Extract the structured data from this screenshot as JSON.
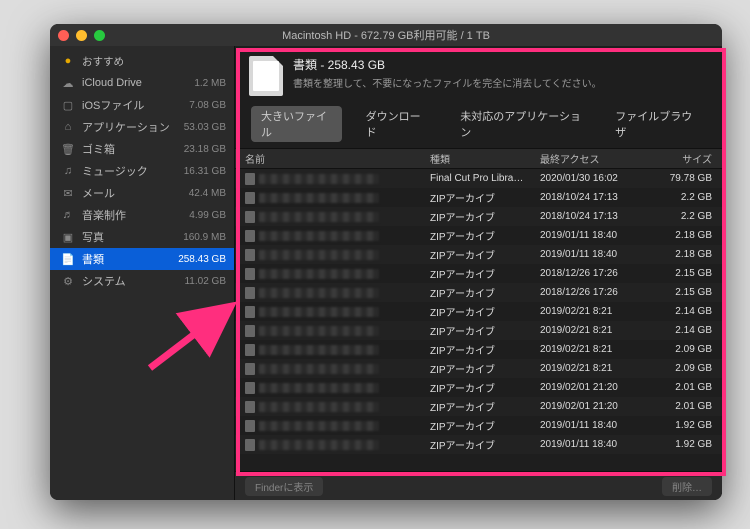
{
  "window_title": "Macintosh HD - 672.79 GB利用可能 / 1 TB",
  "sidebar": {
    "header": {
      "label": "おすすめ",
      "icon": "●"
    },
    "items": [
      {
        "icon": "☁",
        "label": "iCloud Drive",
        "size": "1.2 MB"
      },
      {
        "icon": "▢",
        "label": "iOSファイル",
        "size": "7.08 GB"
      },
      {
        "icon": "⌂",
        "label": "アプリケーション",
        "size": "53.03 GB"
      },
      {
        "icon": "🗑",
        "label": "ゴミ箱",
        "size": "23.18 GB"
      },
      {
        "icon": "♫",
        "label": "ミュージック",
        "size": "16.31 GB"
      },
      {
        "icon": "✉",
        "label": "メール",
        "size": "42.4 MB"
      },
      {
        "icon": "♬",
        "label": "音楽制作",
        "size": "4.99 GB"
      },
      {
        "icon": "▣",
        "label": "写真",
        "size": "160.9 MB"
      },
      {
        "icon": "📄",
        "label": "書類",
        "size": "258.43 GB",
        "selected": true
      },
      {
        "icon": "⚙",
        "label": "システム",
        "size": "11.02 GB"
      }
    ]
  },
  "hero": {
    "title": "書類 - 258.43 GB",
    "subtitle": "書類を整理して、不要になったファイルを完全に消去してください。"
  },
  "tabs": [
    {
      "label": "大きいファイル",
      "active": true
    },
    {
      "label": "ダウンロード"
    },
    {
      "label": "未対応のアプリケーション"
    },
    {
      "label": "ファイルブラウザ"
    }
  ],
  "columns": {
    "name": "名前",
    "kind": "種類",
    "date": "最終アクセス",
    "size": "サイズ"
  },
  "rows": [
    {
      "kind": "Final Cut Pro Libra…",
      "date": "2020/01/30 16:02",
      "size": "79.78 GB"
    },
    {
      "kind": "ZIPアーカイブ",
      "date": "2018/10/24 17:13",
      "size": "2.2 GB"
    },
    {
      "kind": "ZIPアーカイブ",
      "date": "2018/10/24 17:13",
      "size": "2.2 GB"
    },
    {
      "kind": "ZIPアーカイブ",
      "date": "2019/01/11 18:40",
      "size": "2.18 GB"
    },
    {
      "kind": "ZIPアーカイブ",
      "date": "2019/01/11 18:40",
      "size": "2.18 GB"
    },
    {
      "kind": "ZIPアーカイブ",
      "date": "2018/12/26 17:26",
      "size": "2.15 GB"
    },
    {
      "kind": "ZIPアーカイブ",
      "date": "2018/12/26 17:26",
      "size": "2.15 GB"
    },
    {
      "kind": "ZIPアーカイブ",
      "date": "2019/02/21 8:21",
      "size": "2.14 GB"
    },
    {
      "kind": "ZIPアーカイブ",
      "date": "2019/02/21 8:21",
      "size": "2.14 GB"
    },
    {
      "kind": "ZIPアーカイブ",
      "date": "2019/02/21 8:21",
      "size": "2.09 GB"
    },
    {
      "kind": "ZIPアーカイブ",
      "date": "2019/02/21 8:21",
      "size": "2.09 GB"
    },
    {
      "kind": "ZIPアーカイブ",
      "date": "2019/02/01 21:20",
      "size": "2.01 GB"
    },
    {
      "kind": "ZIPアーカイブ",
      "date": "2019/02/01 21:20",
      "size": "2.01 GB"
    },
    {
      "kind": "ZIPアーカイブ",
      "date": "2019/01/11 18:40",
      "size": "1.92 GB"
    },
    {
      "kind": "ZIPアーカイブ",
      "date": "2019/01/11 18:40",
      "size": "1.92 GB"
    }
  ],
  "footer": {
    "show_in_finder": "Finderに表示",
    "delete": "削除…"
  }
}
